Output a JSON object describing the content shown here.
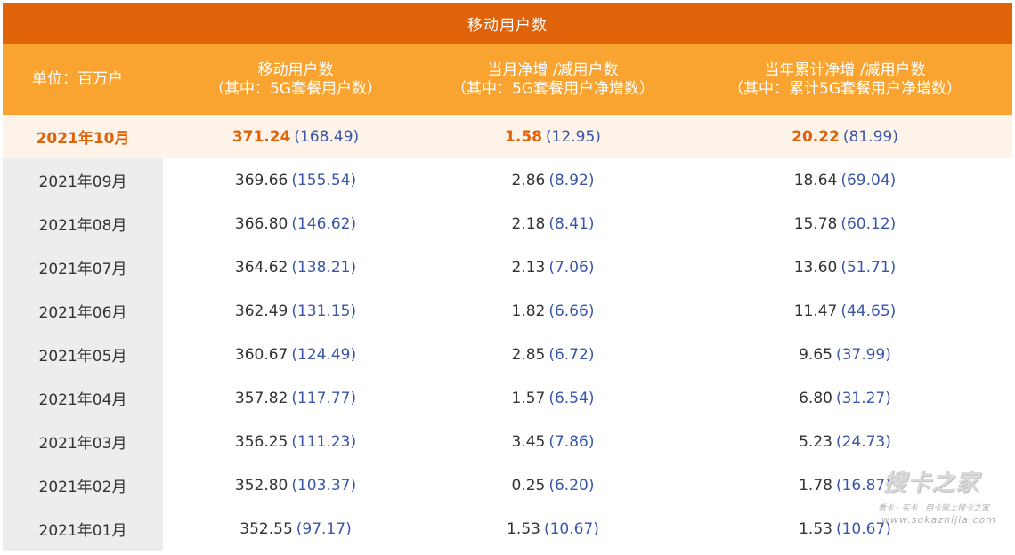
{
  "title": "移动用户数",
  "header": {
    "unit": "单位：百万户",
    "col1_line1": "移动用户数",
    "col1_line2": "（其中：5G套餐用户数）",
    "col2_line1": "当月净增 /减用户数",
    "col2_line2": "（其中：5G套餐用户净增数）",
    "col3_line1": "当年累计净增 /减用户数",
    "col3_line2": "（其中：累计5G套餐用户净增数）"
  },
  "rows": [
    {
      "month": "2021年10月",
      "total": "371.24",
      "total_5g": "(168.49)",
      "monthly": "1.58",
      "monthly_5g": "(12.95)",
      "ytd": "20.22",
      "ytd_5g": "(81.99)"
    },
    {
      "month": "2021年09月",
      "total": "369.66",
      "total_5g": "(155.54)",
      "monthly": "2.86",
      "monthly_5g": "(8.92)",
      "ytd": "18.64",
      "ytd_5g": "(69.04)"
    },
    {
      "month": "2021年08月",
      "total": "366.80",
      "total_5g": "(146.62)",
      "monthly": "2.18",
      "monthly_5g": "(8.41)",
      "ytd": "15.78",
      "ytd_5g": "(60.12)"
    },
    {
      "month": "2021年07月",
      "total": "364.62",
      "total_5g": "(138.21)",
      "monthly": "2.13",
      "monthly_5g": "(7.06)",
      "ytd": "13.60",
      "ytd_5g": "(51.71)"
    },
    {
      "month": "2021年06月",
      "total": "362.49",
      "total_5g": "(131.15)",
      "monthly": "1.82",
      "monthly_5g": "(6.66)",
      "ytd": "11.47",
      "ytd_5g": "(44.65)"
    },
    {
      "month": "2021年05月",
      "total": "360.67",
      "total_5g": "(124.49)",
      "monthly": "2.85",
      "monthly_5g": "(6.72)",
      "ytd": "9.65",
      "ytd_5g": "(37.99)"
    },
    {
      "month": "2021年04月",
      "total": "357.82",
      "total_5g": "(117.77)",
      "monthly": "1.57",
      "monthly_5g": "(6.54)",
      "ytd": "6.80",
      "ytd_5g": "(31.27)"
    },
    {
      "month": "2021年03月",
      "total": "356.25",
      "total_5g": "(111.23)",
      "monthly": "3.45",
      "monthly_5g": "(7.86)",
      "ytd": "5.23",
      "ytd_5g": "(24.73)"
    },
    {
      "month": "2021年02月",
      "total": "352.80",
      "total_5g": "(103.37)",
      "monthly": "0.25",
      "monthly_5g": "(6.20)",
      "ytd": "1.78",
      "ytd_5g": "(16.87)"
    },
    {
      "month": "2021年01月",
      "total": "352.55",
      "total_5g": "(97.17)",
      "monthly": "1.53",
      "monthly_5g": "(10.67)",
      "ytd": "1.53",
      "ytd_5g": "(10.67)"
    }
  ],
  "watermark": {
    "logo": "搜卡之家",
    "tagline": "看卡 · 买卡 · 用卡就上搜卡之家",
    "url": "www.sokazhijia.com"
  },
  "colors": {
    "title_bg": "#e0630a",
    "header_bg": "#f9a330",
    "highlight_bg": "#fdf3e8",
    "highlight_text": "#e0630a",
    "paren_text": "#3a56a8",
    "month_col_bg": "#ededed"
  }
}
